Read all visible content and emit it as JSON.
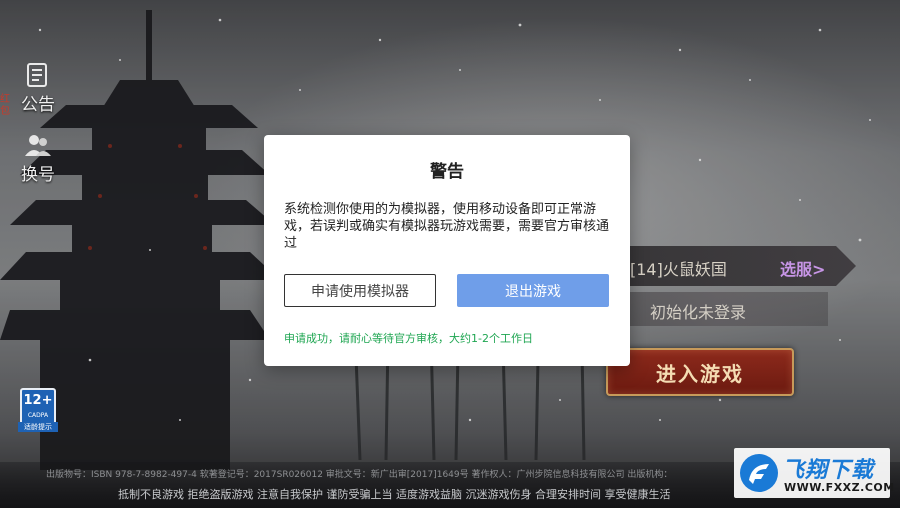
{
  "side_menu": {
    "notice_label": "公告",
    "switch_account_label": "换号",
    "red_tag": "红包"
  },
  "server": {
    "name": "[14]火鼠妖国",
    "select_label": "选服>",
    "role_label": "初始化未登录"
  },
  "enter_game_label": "进入游戏",
  "age_rating": {
    "number": "12+",
    "org": "CADPA",
    "caption": "适龄提示"
  },
  "footer": {
    "license_line": "出版物号：ISBN 978-7-8982-497-4 软著登记号：2017SR026012 审批文号：新广出审[2017]1649号 著作权人：广州步院信息科技有限公司 出版机构：",
    "health_line": "抵制不良游戏 拒绝盗版游戏 注意自我保护 谨防受骗上当 适度游戏益脑 沉迷游戏伤身 合理安排时间 享受健康生活"
  },
  "watermark": {
    "title": "飞翔下载",
    "url": "WWW.FXXZ.COM"
  },
  "dialog": {
    "title": "警告",
    "body": "系统检测你使用的为模拟器，使用移动设备即可正常游戏，若误判或确实有模拟器玩游戏需要，需要官方审核通过",
    "apply_button": "申请使用模拟器",
    "exit_button": "退出游戏",
    "status_message": "申请成功，请耐心等待官方审核，大约1-2个工作日"
  },
  "colors": {
    "exit_button": "#6f9ee9",
    "status_text": "#1fa652",
    "select_server": "#c795e6",
    "enter_button": "#8d2a1c"
  }
}
